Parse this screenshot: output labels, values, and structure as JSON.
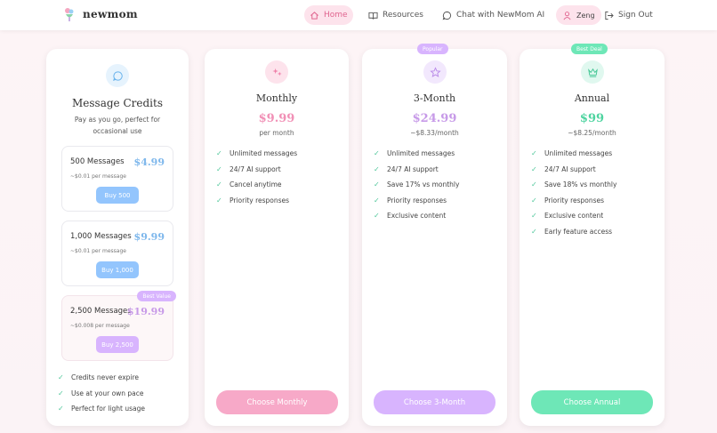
{
  "brand": {
    "name": "newmom"
  },
  "nav": {
    "home": "Home",
    "resources": "Resources",
    "chat": "Chat with NewMom AI",
    "user": "Zeng",
    "signout": "Sign Out"
  },
  "colors": {
    "pink": "#f7a9c8",
    "purple": "#d8b4fe",
    "green": "#6ee7b7",
    "blue": "#93c5fd"
  },
  "credits": {
    "icon": "chat-bubble-icon",
    "title": "Message Credits",
    "description": "Pay as you go, perfect for occasional use",
    "packs": [
      {
        "name": "500 Messages",
        "price": "$4.99",
        "per": "~$0.01 per message",
        "button": "Buy 500"
      },
      {
        "name": "1,000 Messages",
        "price": "$9.99",
        "per": "~$0.01 per message",
        "button": "Buy 1,000"
      },
      {
        "name": "2,500 Messages",
        "price": "$19.99",
        "per": "~$0.008 per message",
        "button": "Buy 2,500",
        "badge": "Best Value"
      }
    ],
    "features": [
      "Credits never expire",
      "Use at your own pace",
      "Perfect for light usage"
    ]
  },
  "plans": [
    {
      "icon": "sparkle-icon",
      "title": "Monthly",
      "price": "$9.99",
      "period": "per month",
      "features": [
        "Unlimited messages",
        "24/7 AI support",
        "Cancel anytime",
        "Priority responses"
      ],
      "button": "Choose Monthly"
    },
    {
      "icon": "star-icon",
      "title": "3-Month",
      "price": "$24.99",
      "period": "~$8.33/month",
      "badge": "Popular",
      "features": [
        "Unlimited messages",
        "24/7 AI support",
        "Save 17% vs monthly",
        "Priority responses",
        "Exclusive content"
      ],
      "button": "Choose 3-Month"
    },
    {
      "icon": "crown-icon",
      "title": "Annual",
      "price": "$99",
      "period": "~$8.25/month",
      "badge": "Best Deal",
      "features": [
        "Unlimited messages",
        "24/7 AI support",
        "Save 18% vs monthly",
        "Priority responses",
        "Exclusive content",
        "Early feature access"
      ],
      "button": "Choose Annual"
    }
  ]
}
